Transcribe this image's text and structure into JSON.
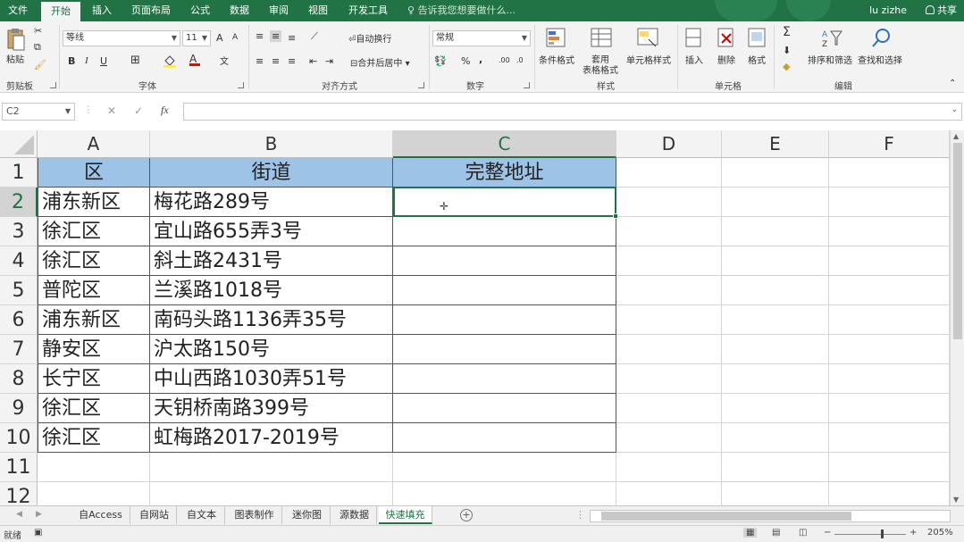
{
  "ribbon_tabs": [
    {
      "label": "文件"
    },
    {
      "label": "开始"
    },
    {
      "label": "插入"
    },
    {
      "label": "页面布局"
    },
    {
      "label": "公式"
    },
    {
      "label": "数据"
    },
    {
      "label": "审阅"
    },
    {
      "label": "视图"
    },
    {
      "label": "开发工具"
    }
  ],
  "tell_me": "告诉我您想要做什么...",
  "user": "lu zizhe",
  "share": "共享",
  "clipboard": {
    "paste": "粘贴",
    "group": "剪贴板"
  },
  "font": {
    "name": "等线",
    "size": "11",
    "bold": "B",
    "italic": "I",
    "underline": "U",
    "grow": "A",
    "shrink": "A",
    "font_color": "A",
    "group": "字体"
  },
  "alignment": {
    "wrap": "自动换行",
    "merge": "合并后居中",
    "group": "对齐方式"
  },
  "number": {
    "format": "常规",
    "percent": "%",
    "comma": ",",
    "group": "数字"
  },
  "styles": {
    "conditional": "条件格式",
    "table_line1": "套用",
    "table_line2": "表格格式",
    "cell_styles": "单元格样式",
    "group": "样式"
  },
  "cells": {
    "insert": "插入",
    "delete": "删除",
    "format": "格式",
    "group": "单元格"
  },
  "editing": {
    "sort": "排序和筛选",
    "find": "查找和选择",
    "group": "编辑"
  },
  "formula_bar": {
    "name_box": "C2",
    "fx": "fx",
    "value": ""
  },
  "columns": [
    "A",
    "B",
    "C",
    "D",
    "E",
    "F"
  ],
  "rows": [
    "1",
    "2",
    "3",
    "4",
    "5",
    "6",
    "7",
    "8",
    "9",
    "10",
    "11",
    "12"
  ],
  "table": {
    "headers": [
      "区",
      "街道",
      "完整地址"
    ],
    "data": [
      [
        "浦东新区",
        "梅花路289号",
        ""
      ],
      [
        "徐汇区",
        "宜山路655弄3号",
        ""
      ],
      [
        "徐汇区",
        "斜土路2431号",
        ""
      ],
      [
        "普陀区",
        "兰溪路1018号",
        ""
      ],
      [
        "浦东新区",
        "南码头路1136弄35号",
        ""
      ],
      [
        "静安区",
        "沪太路150号",
        ""
      ],
      [
        "长宁区",
        "中山西路1030弄51号",
        ""
      ],
      [
        "徐汇区",
        "天钥桥南路399号",
        ""
      ],
      [
        "徐汇区",
        "虹梅路2017-2019号",
        ""
      ]
    ]
  },
  "sheets": [
    "自Access",
    "自网站",
    "自文本",
    "图表制作",
    "迷你图",
    "源数据",
    "快速填充"
  ],
  "active_sheet": "快速填充",
  "status": {
    "ready": "就绪",
    "zoom": "205%"
  },
  "colors": {
    "excel_green": "#217346",
    "header_fill": "#9dc3e6"
  }
}
